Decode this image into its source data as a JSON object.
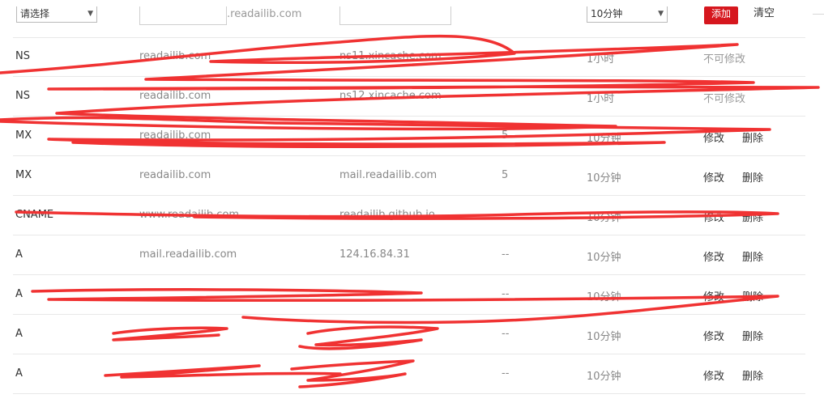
{
  "form": {
    "type_select": "请选择",
    "host_suffix": ".readailib.com",
    "ttl_select": "10分钟",
    "add_label": "添加",
    "clear_label": "清空"
  },
  "records": [
    {
      "type": "NS",
      "host": "readailib.com",
      "value": "ns11.xincache.com",
      "priority": "",
      "ttl": "1小时",
      "fixed": "不可修改"
    },
    {
      "type": "NS",
      "host": "readailib.com",
      "value": "ns12.xincache.com",
      "priority": "",
      "ttl": "1小时",
      "fixed": "不可修改"
    },
    {
      "type": "MX",
      "host": "readailib.com",
      "value": "",
      "priority": "5",
      "ttl": "10分钟",
      "edit": "修改",
      "delete": "删除"
    },
    {
      "type": "MX",
      "host": "readailib.com",
      "value": "mail.readailib.com",
      "priority": "5",
      "ttl": "10分钟",
      "edit": "修改",
      "delete": "删除"
    },
    {
      "type": "CNAME",
      "host": "www.readailib.com",
      "value": "readailib.github.io",
      "priority": "",
      "ttl": "10分钟",
      "edit": "修改",
      "delete": "删除"
    },
    {
      "type": "A",
      "host": "mail.readailib.com",
      "value": "124.16.84.31",
      "priority": "--",
      "ttl": "10分钟",
      "edit": "修改",
      "delete": "删除"
    },
    {
      "type": "A",
      "host": "",
      "value": "",
      "priority": "--",
      "ttl": "10分钟",
      "edit": "修改",
      "delete": "删除"
    },
    {
      "type": "A",
      "host": "",
      "value": "",
      "priority": "--",
      "ttl": "10分钟",
      "edit": "修改",
      "delete": "删除"
    },
    {
      "type": "A",
      "host": "",
      "value": "",
      "priority": "--",
      "ttl": "10分钟",
      "edit": "修改",
      "delete": "删除"
    }
  ],
  "colors": {
    "accent": "#d6171e",
    "scribble": "#f03232"
  }
}
